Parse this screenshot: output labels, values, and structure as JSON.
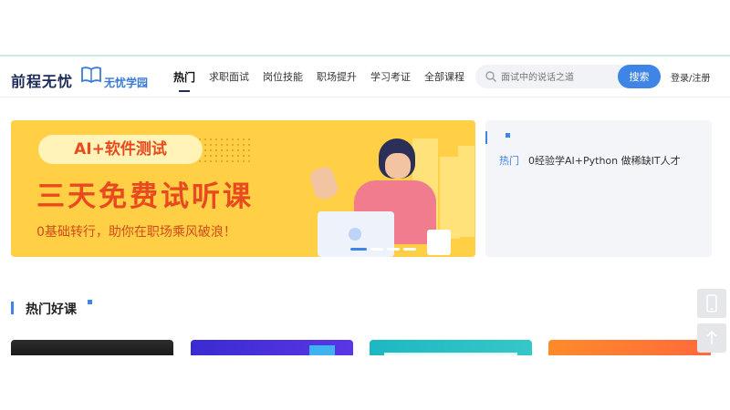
{
  "header": {
    "logo_main": "前程无忧",
    "logo_sub": "无忧学园",
    "nav": [
      {
        "label": "热门",
        "active": true
      },
      {
        "label": "求职面试"
      },
      {
        "label": "岗位技能"
      },
      {
        "label": "职场提升"
      },
      {
        "label": "学习考证"
      },
      {
        "label": "全部课程"
      }
    ],
    "search": {
      "placeholder": "面试中的说话之道",
      "button_label": "搜索"
    },
    "login_label": "登录/注册"
  },
  "banner": {
    "tag": "AI+软件测试",
    "title": "三天免费试听课",
    "subtitle": "0基础转行，助你在职场乘风破浪！"
  },
  "news": {
    "items": [
      {
        "tag": "热门",
        "text": "0经验学AI+Python 做稀缺IT人才"
      }
    ]
  },
  "section": {
    "title": "热门好课"
  },
  "colors": {
    "accent": "#3e85e6",
    "brand": "#1d2b5b",
    "banner": "#ffd046",
    "banner_text": "#e8491e"
  },
  "icons": {
    "search": "search-icon",
    "phone": "phone-icon",
    "back_to_top": "arrow-up-icon",
    "logo": "book-icon"
  }
}
